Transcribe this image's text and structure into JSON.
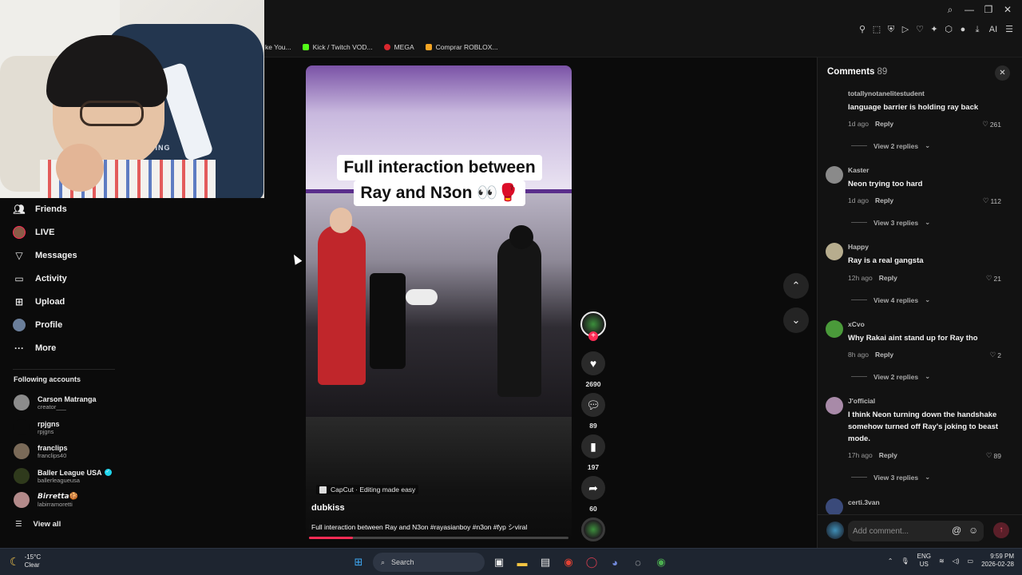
{
  "browser": {
    "window_controls": [
      "search-icon",
      "minimize-icon",
      "restore-icon",
      "close-icon"
    ],
    "bookmarks": [
      {
        "label": "ke You...",
        "color": "#9a9a9a"
      },
      {
        "label": "Kick / Twitch VOD...",
        "color": "#53fc18"
      },
      {
        "label": "MEGA",
        "color": "#d9272e"
      },
      {
        "label": "Comprar ROBLOX...",
        "color": "#f5a524"
      }
    ]
  },
  "webcam": {
    "chair_text": "RACING"
  },
  "sidebar": {
    "nav": [
      {
        "label": "Friends",
        "icon": "friends-icon"
      },
      {
        "label": "LIVE",
        "icon": "live-avatar"
      },
      {
        "label": "Messages",
        "icon": "messages-icon"
      },
      {
        "label": "Activity",
        "icon": "activity-icon"
      },
      {
        "label": "Upload",
        "icon": "upload-icon"
      },
      {
        "label": "Profile",
        "icon": "profile-avatar"
      },
      {
        "label": "More",
        "icon": "more-icon"
      }
    ],
    "following_title": "Following accounts",
    "accounts": [
      {
        "name": "Carson Matranga",
        "handle": "creator___",
        "verified": false
      },
      {
        "name": "rpjgns",
        "handle": "rpjgns",
        "verified": false
      },
      {
        "name": "franclips",
        "handle": "franclips40",
        "verified": false
      },
      {
        "name": "Baller League USA",
        "handle": "ballerleagueusa",
        "verified": true
      },
      {
        "name": "𝘽𝙞𝙧𝙧𝙚𝙩𝙩𝙖🍪",
        "handle": "labirramoretti",
        "verified": false
      }
    ],
    "view_all": "View all"
  },
  "video": {
    "caption_line1": "Full interaction between",
    "caption_line2": "Ray and N3on 👀🥊",
    "capcut": "CapCut · Editing made easy",
    "author": "dubkiss",
    "description": "Full interaction between Ray and N3on #rayasianboy #n3on #fyp シviral",
    "progress": 0.17
  },
  "actions": {
    "likes": "2690",
    "comments": "89",
    "saves": "197",
    "shares": "60"
  },
  "comments_panel": {
    "title": "Comments",
    "count": "89",
    "input_placeholder": "Add comment...",
    "items": [
      {
        "user": "totallynotanelitestudent",
        "text": "language barrier is holding ray back",
        "time": "1d ago",
        "reply": "Reply",
        "likes": "261",
        "view_replies": "View 2 replies"
      },
      {
        "user": "Kaster",
        "text": "Neon trying too hard",
        "time": "1d ago",
        "reply": "Reply",
        "likes": "112",
        "view_replies": "View 3 replies"
      },
      {
        "user": "Happy",
        "text": "Ray is a real gangsta",
        "time": "12h ago",
        "reply": "Reply",
        "likes": "21",
        "view_replies": "View 4 replies"
      },
      {
        "user": "xCvo",
        "text": "Why Rakai aint stand up for Ray tho",
        "time": "8h ago",
        "reply": "Reply",
        "likes": "2",
        "view_replies": "View 2 replies"
      },
      {
        "user": "J'official",
        "text": "I think Neon turning down the handshake somehow turned off Ray's joking to beast mode.",
        "time": "17h ago",
        "reply": "Reply",
        "likes": "89",
        "view_replies": "View 3 replies"
      },
      {
        "user": "certi.3van",
        "text": "",
        "time": "",
        "reply": "",
        "likes": "",
        "view_replies": ""
      }
    ]
  },
  "taskbar": {
    "temp": "-15°C",
    "weather": "Clear",
    "search": "Search",
    "lang1": "ENG",
    "lang2": "US",
    "time": "9:59 PM",
    "date": "2026-02-28"
  }
}
